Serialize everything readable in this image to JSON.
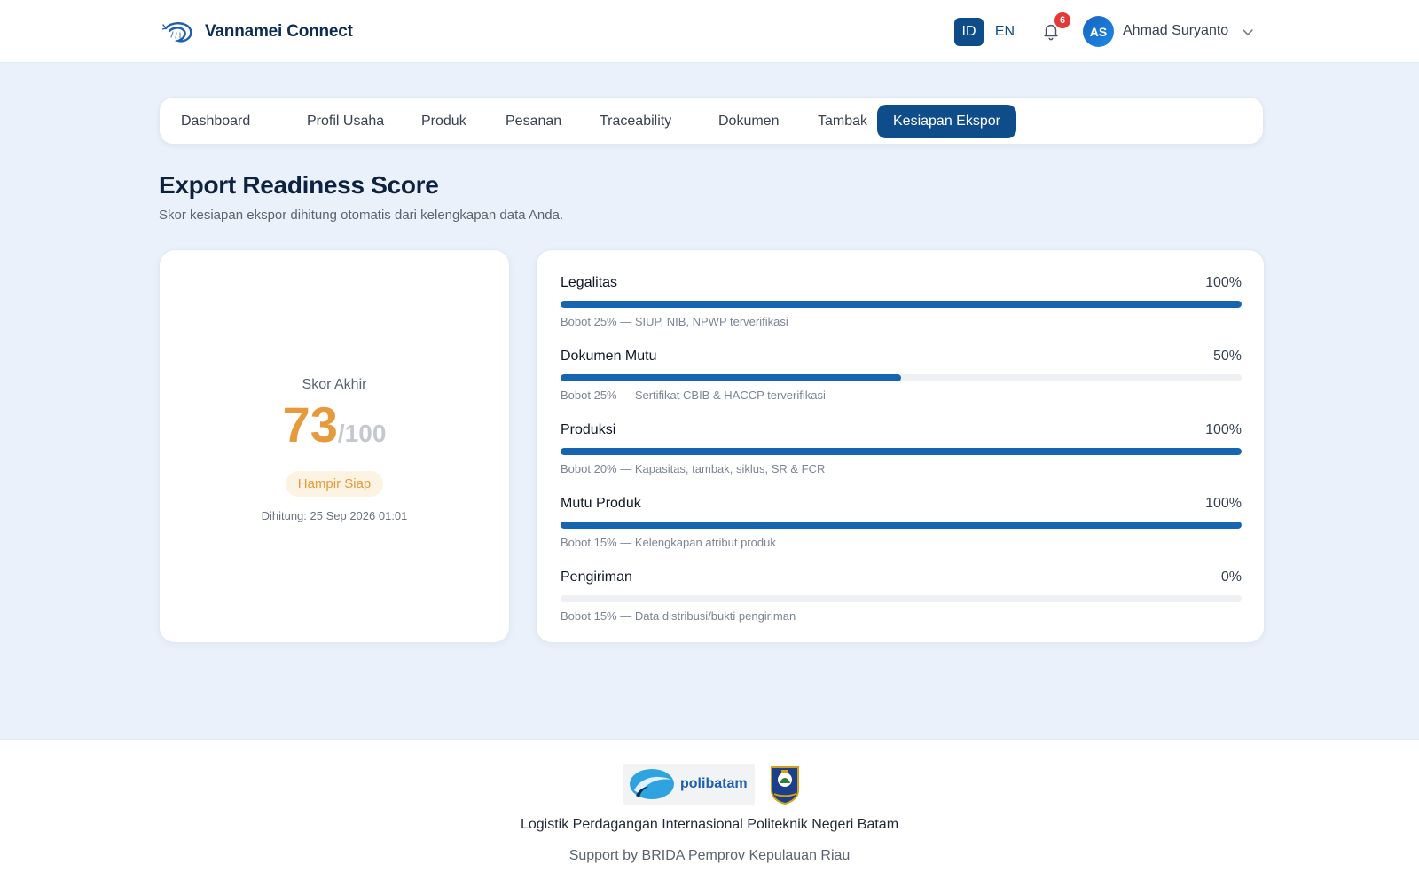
{
  "header": {
    "brand": "Vannamei Connect",
    "lang_id": "ID",
    "lang_en": "EN",
    "notification_count": "6",
    "avatar_initials": "AS",
    "user_name": "Ahmad Suryanto"
  },
  "tabs": [
    {
      "label": "Dashboard"
    },
    {
      "label": "Profil Usaha"
    },
    {
      "label": "Produk"
    },
    {
      "label": "Pesanan"
    },
    {
      "label": "Traceability"
    },
    {
      "label": "Dokumen"
    },
    {
      "label": "Tambak"
    },
    {
      "label": "Kesiapan Ekspor",
      "active": true
    }
  ],
  "page": {
    "title": "Export Readiness Score",
    "subtitle": "Skor kesiapan ekspor dihitung otomatis dari kelengkapan data Anda."
  },
  "score": {
    "label": "Skor Akhir",
    "value": "73",
    "max": "/100",
    "status": "Hampir Siap",
    "computed_at": "Dihitung: 25 Sep 2026 01:01"
  },
  "metrics": [
    {
      "name": "Legalitas",
      "percent_label": "100%",
      "percent": 100,
      "note": "Bobot 25% — SIUP, NIB, NPWP terverifikasi"
    },
    {
      "name": "Dokumen Mutu",
      "percent_label": "50%",
      "percent": 50,
      "note": "Bobot 25% — Sertifikat CBIB & HACCP terverifikasi"
    },
    {
      "name": "Produksi",
      "percent_label": "100%",
      "percent": 100,
      "note": "Bobot 20% — Kapasitas, tambak, siklus, SR & FCR"
    },
    {
      "name": "Mutu Produk",
      "percent_label": "100%",
      "percent": 100,
      "note": "Bobot 15% — Kelengkapan atribut produk"
    },
    {
      "name": "Pengiriman",
      "percent_label": "0%",
      "percent": 0,
      "note": "Bobot 15% — Data distribusi/bukti pengiriman"
    }
  ],
  "footer": {
    "poli_logo_text": "polibatam",
    "line1": "Logistik Perdagangan Internasional Politeknik Negeri Batam",
    "line2": "Support by BRIDA Pemprov Kepulauan Riau"
  },
  "colors": {
    "primary": "#0f4c8a",
    "bar": "#1565b0",
    "score": "#e69a3c",
    "badge": "#e53935"
  }
}
